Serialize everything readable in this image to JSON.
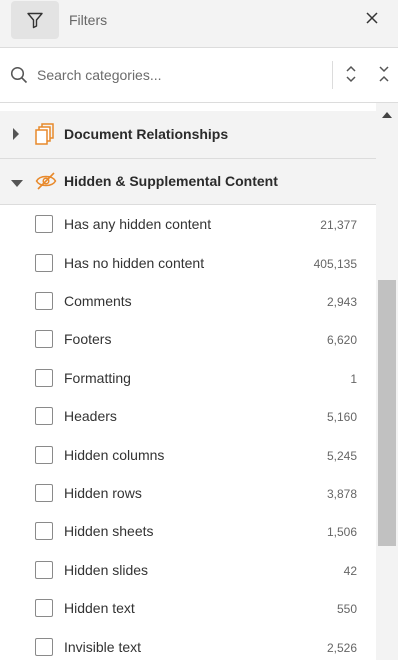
{
  "header": {
    "title": "Filters"
  },
  "search": {
    "placeholder": "Search categories..."
  },
  "categories": [
    {
      "label": "Document Relationships"
    },
    {
      "label": "Hidden & Supplemental Content"
    }
  ],
  "items": [
    {
      "label": "Has any hidden content",
      "count": "21,377"
    },
    {
      "label": "Has no hidden content",
      "count": "405,135"
    },
    {
      "label": "Comments",
      "count": "2,943"
    },
    {
      "label": "Footers",
      "count": "6,620"
    },
    {
      "label": "Formatting",
      "count": "1"
    },
    {
      "label": "Headers",
      "count": "5,160"
    },
    {
      "label": "Hidden columns",
      "count": "5,245"
    },
    {
      "label": "Hidden rows",
      "count": "3,878"
    },
    {
      "label": "Hidden sheets",
      "count": "1,506"
    },
    {
      "label": "Hidden slides",
      "count": "42"
    },
    {
      "label": "Hidden text",
      "count": "550"
    },
    {
      "label": "Invisible text",
      "count": "2,526"
    }
  ],
  "colors": {
    "accent": "#e8892b",
    "header_bg": "#f3f3f3",
    "border": "#dcdcdc"
  },
  "icons": [
    "filter-icon",
    "close-icon",
    "search-icon",
    "expand-all-icon",
    "collapse-all-icon",
    "chevron-right-icon",
    "chevron-down-icon",
    "documents-icon",
    "eye-slash-icon"
  ]
}
